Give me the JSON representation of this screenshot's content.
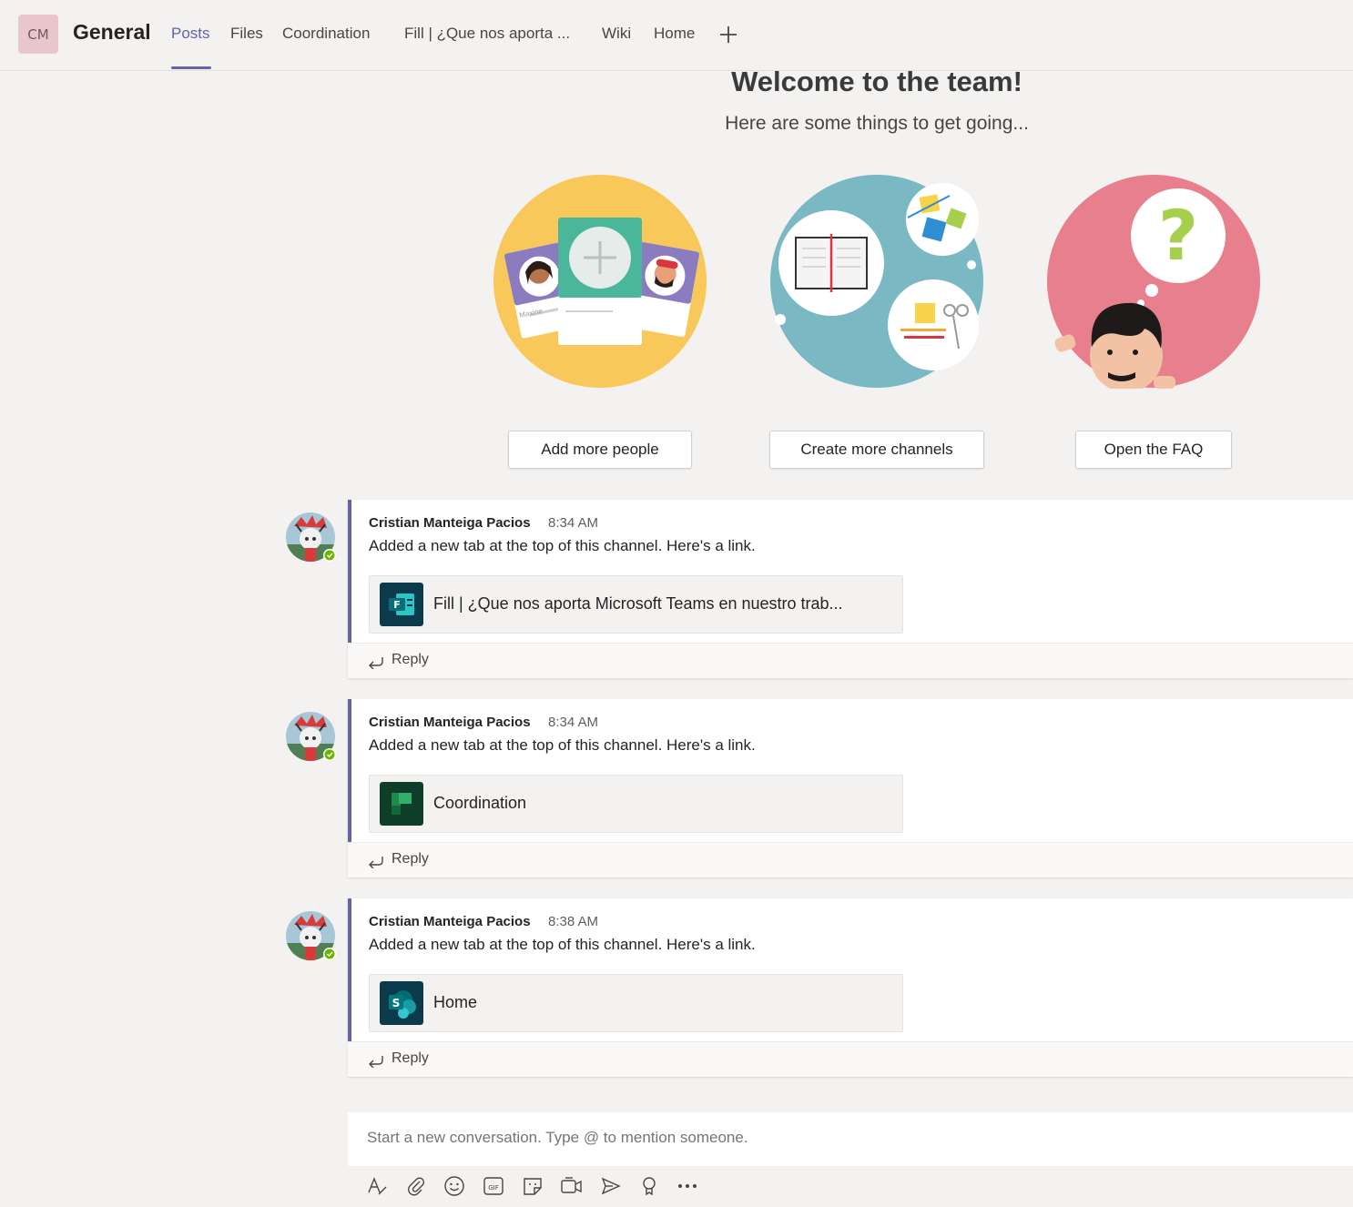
{
  "header": {
    "team_initials": "CM",
    "channel_name": "General",
    "tabs": [
      {
        "label": "Posts",
        "active": true
      },
      {
        "label": "Files"
      },
      {
        "label": "Coordination"
      },
      {
        "label": "Fill | ¿Que nos aporta ..."
      },
      {
        "label": "Wiki"
      },
      {
        "label": "Home"
      }
    ],
    "add_tab_icon": "plus-icon"
  },
  "welcome": {
    "title": "Welcome to the team!",
    "subtitle": "Here are some things to get going...",
    "illustration_name_tag": "Maxine",
    "actions": [
      {
        "label": "Add more people",
        "illustration": "people-cards"
      },
      {
        "label": "Create more channels",
        "illustration": "notebook-bubbles"
      },
      {
        "label": "Open the FAQ",
        "illustration": "question-person"
      }
    ]
  },
  "posts": [
    {
      "author": "Cristian Manteiga Pacios",
      "time": "8:34 AM",
      "text": "Added a new tab at the top of this channel. Here's a link.",
      "card_title": "Fill | ¿Que nos aporta Microsoft Teams en nuestro trab...",
      "card_icon": "forms-icon",
      "reply_label": "Reply"
    },
    {
      "author": "Cristian Manteiga Pacios",
      "time": "8:34 AM",
      "text": "Added a new tab at the top of this channel. Here's a link.",
      "card_title": "Coordination",
      "card_icon": "planner-icon",
      "reply_label": "Reply"
    },
    {
      "author": "Cristian Manteiga Pacios",
      "time": "8:38 AM",
      "text": "Added a new tab at the top of this channel. Here's a link.",
      "card_title": "Home",
      "card_icon": "sharepoint-icon",
      "reply_label": "Reply"
    }
  ],
  "compose": {
    "placeholder": "Start a new conversation. Type @ to mention someone."
  },
  "toolbar": [
    "format-icon",
    "attach-icon",
    "emoji-icon",
    "gif-icon",
    "sticker-icon",
    "meet-now-icon",
    "stream-icon",
    "praise-icon",
    "more-options-icon"
  ],
  "colors": {
    "accent": "#6264a7",
    "background": "#f3f2f1",
    "presence_available": "#6bb700",
    "people_circle": "#f8c95a",
    "channels_circle": "#7ab8c4",
    "faq_circle": "#e77f8c"
  }
}
